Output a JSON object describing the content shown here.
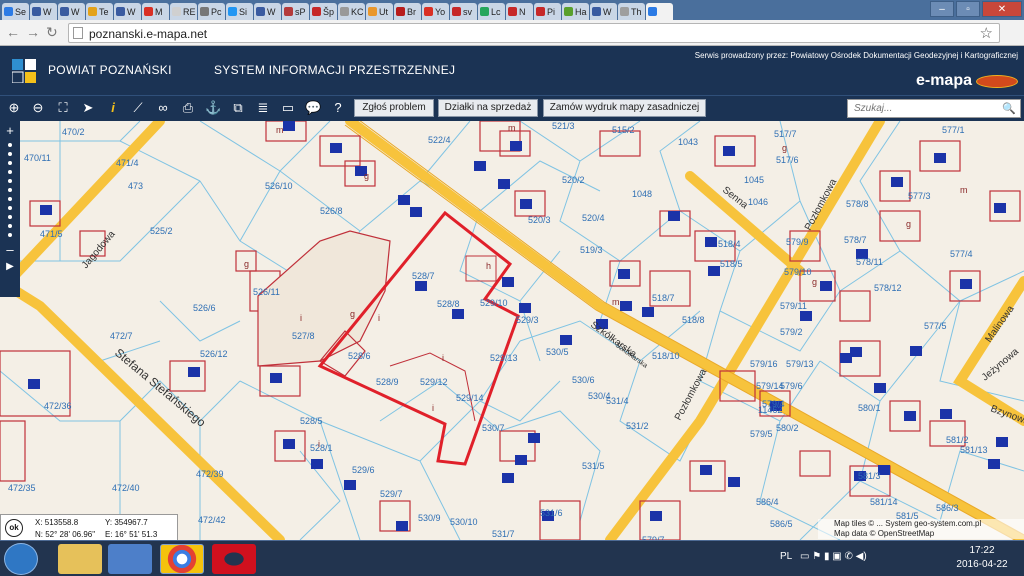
{
  "browser": {
    "tabs": [
      "Se",
      "W",
      "W",
      "Te",
      "W",
      "M",
      "RE",
      "Pc",
      "Si",
      "W",
      "sP",
      "Šp",
      "KC",
      "Ut",
      "Br",
      "Yo",
      "sv",
      "Lc",
      "N",
      "Pi",
      "Ha",
      "W",
      "Th",
      ""
    ],
    "address": "poznanski.e-mapa.net"
  },
  "header": {
    "org": "POWIAT POZNAŃSKI",
    "system": "SYSTEM INFORMACJI PRZESTRZENNEJ",
    "service": "Serwis prowadzony przez: Powiatowy Ośrodek Dokumentacji Geodezyjnej i Kartograficznej",
    "brand": "e-mapa"
  },
  "toolbar": {
    "buttons": [
      "Zgłoś problem",
      "Działki na sprzedaż",
      "Zamów wydruk mapy zasadniczej"
    ],
    "search_placeholder": "Szukaj...",
    "tool_icons": [
      "zoom-in",
      "zoom-out",
      "zoom-extent",
      "pointer",
      "info",
      "measure",
      "link",
      "print",
      "anchor",
      "select",
      "layers",
      "panel",
      "comment",
      "help"
    ]
  },
  "map": {
    "streets": [
      "Jagodowa",
      "Stefana Stefańskiego",
      "Szkółkarska",
      "Szkółkarska",
      "Pozłomkowa",
      "Pozłomkowa",
      "Senna",
      "Malinowa",
      "Jeżynowa",
      "Bzynowa"
    ],
    "parcels": [
      "470/2",
      "470/11",
      "471/4",
      "471/5",
      "473",
      "525/2",
      "526/10",
      "526/8",
      "526/6",
      "526/11",
      "526/12",
      "472/7",
      "472/36",
      "472/35",
      "472/40",
      "472/39",
      "472/42",
      "527/8",
      "528/6",
      "528/5",
      "528/1",
      "528/7",
      "528/8",
      "528/9",
      "529/10",
      "529/6",
      "529/7",
      "529/12",
      "529/13",
      "529/14",
      "530/9",
      "530/10",
      "530/7",
      "531/7",
      "531/6",
      "531/5",
      "531/4",
      "531/2",
      "530/5",
      "530/6",
      "530/4",
      "529/3",
      "520/4",
      "520/3",
      "520/2",
      "522/4",
      "521/3",
      "515/2",
      "1043",
      "1048",
      "1045",
      "1046",
      "517/7",
      "517/6",
      "518/4",
      "518/5",
      "518/7",
      "518/8",
      "518/10",
      "519/3",
      "578/8",
      "578/7",
      "578/11",
      "578/12",
      "577/3",
      "577/4",
      "577/1",
      "577/5",
      "579/10",
      "579/11",
      "579/2",
      "579/16",
      "579/13",
      "579/14",
      "579/6",
      "579/5",
      "580/2",
      "580/1",
      "581/3",
      "581/2",
      "581/13",
      "581/14",
      "581/5",
      "586/3",
      "586/4",
      "586/5",
      "579/7",
      "579/9",
      "579/4",
      "11462"
    ],
    "symbols": [
      "m",
      "g",
      "h",
      "i",
      "i",
      "i",
      "i",
      "g",
      "g",
      "m",
      "g",
      "g",
      "m",
      "m",
      "g",
      "i"
    ]
  },
  "coords": {
    "ok": "ok",
    "x": "X: 513558.8",
    "y": "Y: 354967.7",
    "n": "N: 52° 28' 06.96\"",
    "e": "E: 16° 51' 51.3"
  },
  "credit": {
    "line1": "Map tiles © ... System geo-system.com.pl",
    "line2": "Map data © OpenStreetMap openstreetmap.org/copyright"
  },
  "taskbar": {
    "lang": "PL",
    "time": "17:22",
    "date": "2016-04-22"
  },
  "colors": {
    "header_bg": "#1b3354",
    "map_bg": "#f4efe6",
    "road": "#f7c33c",
    "parcel_line": "#7fc3e3",
    "building": "#c0303a",
    "selection": "#e0202a",
    "label": "#2f6fb4"
  }
}
